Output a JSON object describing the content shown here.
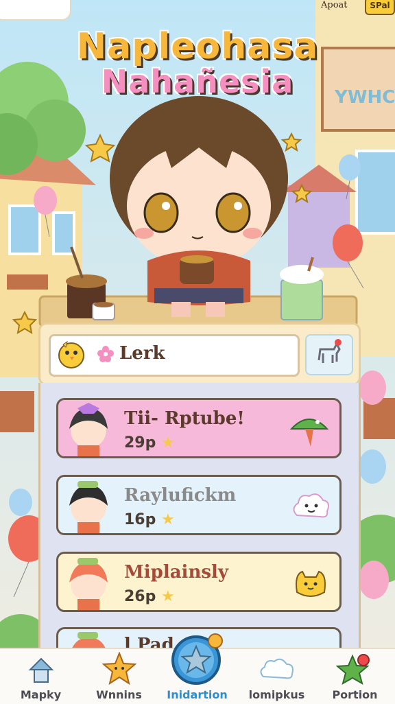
{
  "header": {
    "top_right_label": "Apoat",
    "top_right_badge": "SPal",
    "title_line1": "Napleohasa",
    "title_line2": "Nahañesia"
  },
  "search": {
    "text": "Lerk"
  },
  "list": {
    "rows": [
      {
        "name": "Tii- Rptube!",
        "points": "29p",
        "bg": "#f7b9d9",
        "name_color": "#5a3a2a",
        "icon": "watermelon-slice-icon"
      },
      {
        "name": "Raylufickm",
        "points": "16p",
        "bg": "#e4f3fb",
        "name_color": "#8a8a8a",
        "icon": "cloud-face-icon"
      },
      {
        "name": "Miplainsly",
        "points": "26p",
        "bg": "#fdf3cf",
        "name_color": "#a64a3a",
        "icon": "yellow-cat-icon"
      },
      {
        "name": "l Pad",
        "points": "",
        "bg": "#e4f3fb",
        "name_color": "#5a3a2a",
        "icon": "partial-row"
      }
    ]
  },
  "nav": {
    "items": [
      {
        "label": "Mapky",
        "icon": "home-icon",
        "active": false
      },
      {
        "label": "Wnnins",
        "icon": "star-face-icon",
        "active": false
      },
      {
        "label": "Inidartion",
        "icon": "star-button-icon",
        "active": true
      },
      {
        "label": "lomipkus",
        "icon": "cloud-icon",
        "active": false
      },
      {
        "label": "Portion",
        "icon": "potion-icon",
        "active": false
      }
    ]
  },
  "colors": {
    "accent": "#2e8fd0",
    "title_yellow": "#f7b73b",
    "title_pink": "#f48fc0"
  }
}
